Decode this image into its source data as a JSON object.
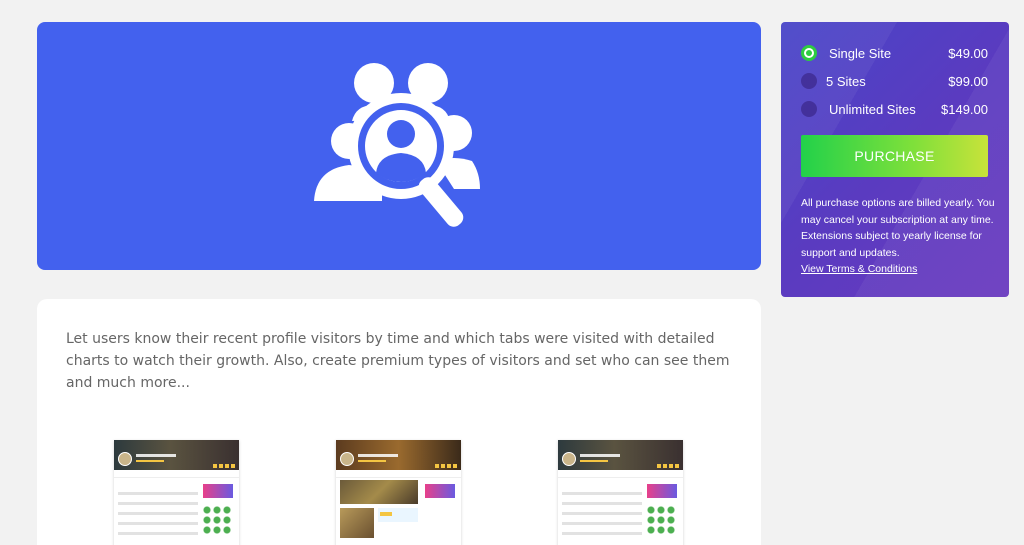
{
  "description": "Let users know their recent profile visitors by time and which tabs were visited with detailed charts to watch their growth. Also, create premium types of visitors and set who can see them and much more...",
  "colors": {
    "hero_bg": "#4361ee",
    "accent_green": "#2ecc40",
    "pricing_bg": "#5a3bc0"
  },
  "hero": {
    "icon": "profile-visitors-search-icon"
  },
  "pricing": {
    "options": [
      {
        "label": "Single Site",
        "price": "$49.00",
        "selected": true
      },
      {
        "label": "5 Sites",
        "price": "$99.00",
        "selected": false
      },
      {
        "label": "Unlimited Sites",
        "price": "$149.00",
        "selected": false
      }
    ],
    "purchase_label": "PURCHASE",
    "notes": "All purchase options are billed yearly. You may cancel your subscription at any time. Extensions subject to yearly license for support and updates.",
    "terms_link": "View Terms & Conditions"
  }
}
